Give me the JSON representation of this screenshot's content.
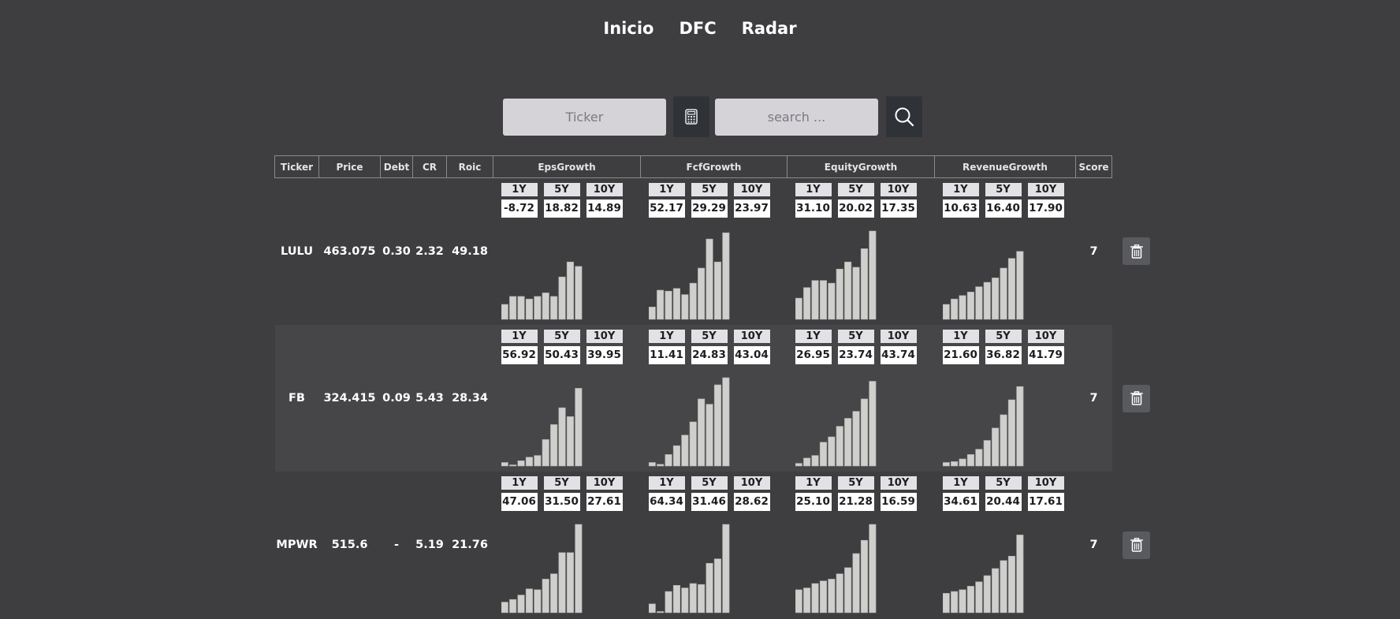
{
  "nav": {
    "items": [
      "Inicio",
      "DFC",
      "Radar"
    ]
  },
  "search": {
    "ticker_placeholder": "Ticker",
    "query_placeholder": "search ...",
    "calculator_icon": "calculator-icon",
    "search_icon": "search-icon"
  },
  "table": {
    "headers": [
      "Ticker",
      "Price",
      "Debt",
      "CR",
      "Roic",
      "EpsGrowth",
      "FcfGrowth",
      "EquityGrowth",
      "RevenueGrowth",
      "Score"
    ],
    "period_labels": [
      "1Y",
      "5Y",
      "10Y"
    ],
    "rows": [
      {
        "ticker": "LULU",
        "price": "463.075",
        "debt": "0.30",
        "cr": "2.32",
        "roic": "49.18",
        "score": "7",
        "growth": [
          {
            "name": "EpsGrowth",
            "values": [
              "-8.72",
              "18.82",
              "14.89"
            ],
            "bars": [
              0.17,
              0.26,
              0.26,
              0.23,
              0.26,
              0.3,
              0.26,
              0.48,
              0.65,
              0.6
            ]
          },
          {
            "name": "FcfGrowth",
            "values": [
              "52.17",
              "29.29",
              "23.97"
            ],
            "bars": [
              0.14,
              0.33,
              0.32,
              0.35,
              0.28,
              0.41,
              0.58,
              0.91,
              0.65,
              0.98
            ]
          },
          {
            "name": "EquityGrowth",
            "values": [
              "31.10",
              "20.02",
              "17.35"
            ],
            "bars": [
              0.24,
              0.36,
              0.44,
              0.44,
              0.41,
              0.57,
              0.65,
              0.59,
              0.8,
              1.0
            ]
          },
          {
            "name": "RevenueGrowth",
            "values": [
              "10.63",
              "16.40",
              "17.90"
            ],
            "bars": [
              0.17,
              0.23,
              0.27,
              0.31,
              0.37,
              0.42,
              0.47,
              0.58,
              0.69,
              0.77
            ]
          }
        ]
      },
      {
        "ticker": "FB",
        "price": "324.415",
        "debt": "0.09",
        "cr": "5.43",
        "roic": "28.34",
        "score": "7",
        "growth": [
          {
            "name": "EpsGrowth",
            "values": [
              "56.92",
              "50.43",
              "39.95"
            ],
            "bars": [
              0.04,
              0.0,
              0.06,
              0.1,
              0.12,
              0.3,
              0.47,
              0.66,
              0.56,
              0.88
            ]
          },
          {
            "name": "FcfGrowth",
            "values": [
              "11.41",
              "24.83",
              "43.04"
            ],
            "bars": [
              0.04,
              0.02,
              0.13,
              0.23,
              0.35,
              0.5,
              0.76,
              0.7,
              0.92,
              1.0
            ]
          },
          {
            "name": "EquityGrowth",
            "values": [
              "26.95",
              "23.74",
              "43.74"
            ],
            "bars": [
              0.03,
              0.09,
              0.12,
              0.27,
              0.33,
              0.45,
              0.54,
              0.62,
              0.76,
              0.96
            ]
          },
          {
            "name": "RevenueGrowth",
            "values": [
              "21.60",
              "36.82",
              "41.79"
            ],
            "bars": [
              0.04,
              0.05,
              0.08,
              0.13,
              0.19,
              0.29,
              0.43,
              0.58,
              0.75,
              0.9
            ]
          }
        ]
      },
      {
        "ticker": "MPWR",
        "price": "515.6",
        "debt": "-",
        "cr": "5.19",
        "roic": "21.76",
        "score": "7",
        "growth": [
          {
            "name": "EpsGrowth",
            "values": [
              "47.06",
              "31.50",
              "27.61"
            ],
            "bars": [
              0.12,
              0.15,
              0.2,
              0.27,
              0.26,
              0.38,
              0.44,
              0.68,
              0.68,
              1.0
            ]
          },
          {
            "name": "FcfGrowth",
            "values": [
              "64.34",
              "31.46",
              "28.62"
            ],
            "bars": [
              0.1,
              0.0,
              0.24,
              0.31,
              0.28,
              0.33,
              0.32,
              0.56,
              0.61,
              1.0
            ]
          },
          {
            "name": "EquityGrowth",
            "values": [
              "25.10",
              "21.28",
              "16.59"
            ],
            "bars": [
              0.26,
              0.28,
              0.33,
              0.36,
              0.38,
              0.44,
              0.51,
              0.67,
              0.82,
              1.0
            ]
          },
          {
            "name": "RevenueGrowth",
            "values": [
              "34.61",
              "20.44",
              "17.61"
            ],
            "bars": [
              0.22,
              0.24,
              0.26,
              0.3,
              0.35,
              0.42,
              0.5,
              0.59,
              0.64,
              0.88
            ]
          }
        ]
      }
    ]
  },
  "colors": {
    "background": "#3e3e40",
    "row_alt": "#464648",
    "bar_fill": "#cfd0cd",
    "bar_stroke": "#a9aaa6"
  }
}
